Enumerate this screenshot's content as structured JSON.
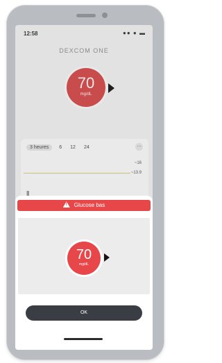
{
  "status_bar": {
    "time": "12:58",
    "icons": "●● ● ▬"
  },
  "brand": "DEXCOM ONE",
  "background": {
    "glucose_value": "70",
    "glucose_unit": "mg/dL",
    "tabs": [
      "3 heures",
      "6",
      "12",
      "24"
    ],
    "more_label": "…",
    "ref_labels": [
      "~16",
      "~13.9"
    ],
    "dots_label": "|||"
  },
  "alert": {
    "title": "Glucose bas",
    "value": "70",
    "unit": "mg/dL",
    "ok_label": "OK"
  },
  "colors": {
    "alert_red": "#e8474a",
    "button_dark": "#3a3e44"
  }
}
